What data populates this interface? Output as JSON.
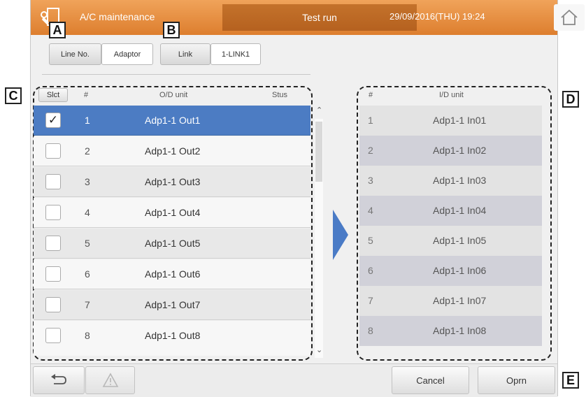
{
  "header": {
    "title": "A/C maintenance",
    "mode": "Test run",
    "datetime": "29/09/2016(THU) 19:24"
  },
  "callouts": {
    "a": "A",
    "b": "B",
    "c": "C",
    "d": "D",
    "e": "E"
  },
  "toolbar": {
    "line_no_label": "Line No.",
    "adaptor_value": "Adaptor",
    "link_label": "Link",
    "link_value": "1-LINK1"
  },
  "od_table": {
    "select_label": "Slct",
    "col_num": "#",
    "col_unit": "O/D unit",
    "col_status": "Stus",
    "rows": [
      {
        "num": "1",
        "name": "Adp1-1 Out1",
        "mark": "✓"
      },
      {
        "num": "2",
        "name": "Adp1-1 Out2",
        "mark": ""
      },
      {
        "num": "3",
        "name": "Adp1-1 Out3",
        "mark": ""
      },
      {
        "num": "4",
        "name": "Adp1-1 Out4",
        "mark": ""
      },
      {
        "num": "5",
        "name": "Adp1-1 Out5",
        "mark": ""
      },
      {
        "num": "6",
        "name": "Adp1-1 Out6",
        "mark": ""
      },
      {
        "num": "7",
        "name": "Adp1-1 Out7",
        "mark": ""
      },
      {
        "num": "8",
        "name": "Adp1-1 Out8",
        "mark": ""
      }
    ]
  },
  "id_table": {
    "col_num": "#",
    "col_unit": "I/D unit",
    "rows": [
      {
        "num": "1",
        "name": "Adp1-1 In01"
      },
      {
        "num": "2",
        "name": "Adp1-1 In02"
      },
      {
        "num": "3",
        "name": "Adp1-1 In03"
      },
      {
        "num": "4",
        "name": "Adp1-1 In04"
      },
      {
        "num": "5",
        "name": "Adp1-1 In05"
      },
      {
        "num": "6",
        "name": "Adp1-1 In06"
      },
      {
        "num": "7",
        "name": "Adp1-1 In07"
      },
      {
        "num": "8",
        "name": "Adp1-1 In08"
      }
    ]
  },
  "footer": {
    "cancel_label": "Cancel",
    "operation_label": "Oprn"
  },
  "icons": {
    "tool": "tool-icon",
    "home": "home-icon",
    "back": "back-icon",
    "warning": "warning-icon",
    "forward_arrow": "forward-arrow-icon"
  },
  "colors": {
    "header": "#e2873a",
    "header_mid": "#bf6d27",
    "selected_row": "#4c7cc3",
    "arrow": "#4a7bc6",
    "id_row_alt": "#d1d1d9"
  }
}
